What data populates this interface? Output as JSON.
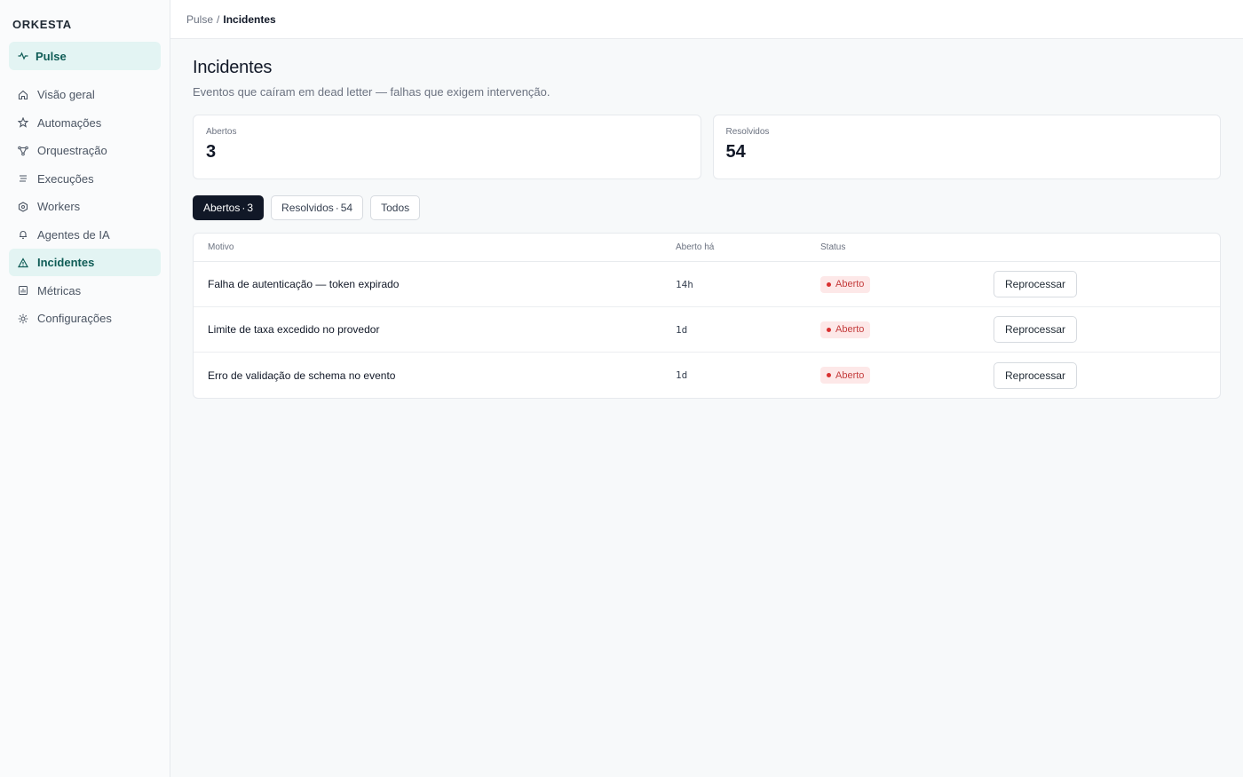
{
  "brand": "ORKESTA",
  "pulse": {
    "label": "Pulse"
  },
  "sidebar": {
    "items": [
      {
        "label": "Visão geral",
        "icon": "home-icon"
      },
      {
        "label": "Automações",
        "icon": "star-icon"
      },
      {
        "label": "Orquestração",
        "icon": "nodes-icon"
      },
      {
        "label": "Execuções",
        "icon": "list-icon"
      },
      {
        "label": "Workers",
        "icon": "hexagon-icon"
      },
      {
        "label": "Agentes de IA",
        "icon": "bell-icon"
      },
      {
        "label": "Incidentes",
        "icon": "warning-icon",
        "active": true
      },
      {
        "label": "Métricas",
        "icon": "chart-icon"
      },
      {
        "label": "Configurações",
        "icon": "gear-icon"
      }
    ]
  },
  "breadcrumb": {
    "root": "Pulse",
    "separator": "/",
    "current": "Incidentes"
  },
  "page": {
    "title": "Incidentes",
    "subtitle": "Eventos que caíram em dead letter — falhas que exigem intervenção."
  },
  "stats": {
    "open": {
      "label": "Abertos",
      "value": "3"
    },
    "resolved": {
      "label": "Resolvidos",
      "value": "54"
    }
  },
  "filters": {
    "open": {
      "label": "Abertos",
      "count": "3"
    },
    "resolved": {
      "label": "Resolvidos",
      "count": "54"
    },
    "all": {
      "label": "Todos"
    },
    "dot": "·"
  },
  "table": {
    "headers": {
      "reason": "Motivo",
      "opened": "Aberto há",
      "status": "Status"
    },
    "rows": [
      {
        "reason": "Falha de autenticação — token expirado",
        "opened": "14h",
        "status": "Aberto",
        "action": "Reprocessar"
      },
      {
        "reason": "Limite de taxa excedido no provedor",
        "opened": "1d",
        "status": "Aberto",
        "action": "Reprocessar"
      },
      {
        "reason": "Erro de validação de schema no evento",
        "opened": "1d",
        "status": "Aberto",
        "action": "Reprocessar"
      }
    ]
  },
  "colors": {
    "accent": "#0f5c56",
    "accent_bg": "#e3f4f3",
    "status_open_bg": "#fde8e8",
    "status_open_fg": "#c43c3c",
    "filter_active_bg": "#111827"
  }
}
